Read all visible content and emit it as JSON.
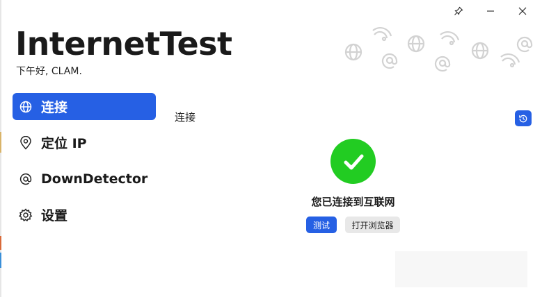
{
  "app": {
    "title": "InternetTest",
    "greeting": "下午好, CLAM."
  },
  "window_controls": {
    "pin_icon": "pin-icon",
    "minimize_icon": "minimize-icon",
    "close_icon": "close-icon"
  },
  "nav": {
    "items": [
      {
        "label": "连接",
        "icon": "globe-icon",
        "active": true
      },
      {
        "label": "定位 IP",
        "icon": "location-pin-icon",
        "active": false
      },
      {
        "label": "DownDetector",
        "icon": "at-icon",
        "active": false
      },
      {
        "label": "设置",
        "icon": "gear-icon",
        "active": false
      }
    ]
  },
  "main": {
    "section_title": "连接",
    "status_text": "您已连接到互联网",
    "test_button": "测试",
    "open_browser_button": "打开浏览器",
    "history_icon": "history-icon"
  },
  "colors": {
    "accent": "#2660e4",
    "success": "#22cc22"
  }
}
